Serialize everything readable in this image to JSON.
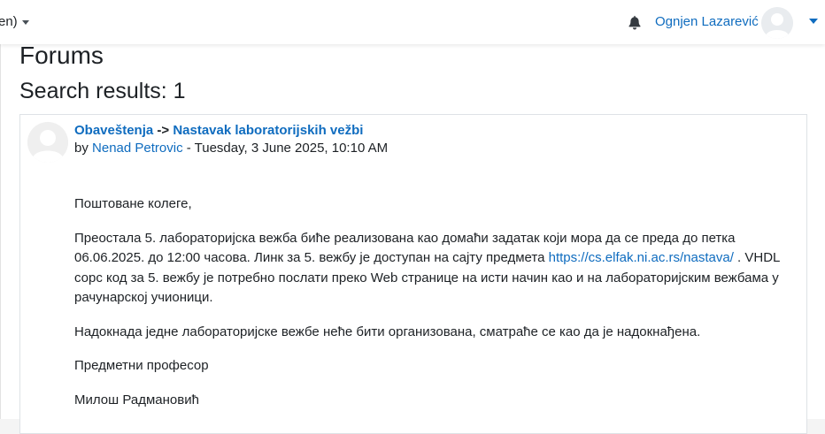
{
  "navbar": {
    "language": "en)",
    "user_name": "Ognjen Lazarević"
  },
  "page": {
    "title": "Forums",
    "results_heading": "Search results: 1"
  },
  "post": {
    "forum": "Obaveštenja",
    "separator": "->",
    "subject": "Nastavak laboratorijskih vežbi",
    "by": "by",
    "author": "Nenad Petrovic",
    "date": "- Tuesday, 3 June 2025, 10:10 AM",
    "body": {
      "greeting": "Поштоване колеге,",
      "p1_before": "Преостала 5. лабораторијска вежба биће реализована као домаћи задатак који мора да се преда до петка 06.06.2025. до 12:00 часова. Линк за 5. вежбу је доступан на сајту предмета",
      "p1_link": "https://cs.elfak.ni.ac.rs/nastava/",
      "p1_after": ". VHDL сорс код за 5. вежбу је потребно послати преко Web странице на исти начин као и на лабораторијским вежбама у рачунарској учионици.",
      "p2": "Надокнада једне лабораторијске вежбе неће бити организована, сматраће се као да је надокнађена.",
      "p3": "Предметни професор",
      "p4": "Милош Радмановић"
    }
  },
  "colors": {
    "link": "#0f6cbf",
    "text": "#1d2125",
    "border": "#dee2e6"
  },
  "icons": [
    "caret-down-icon",
    "bell-icon",
    "avatar"
  ]
}
